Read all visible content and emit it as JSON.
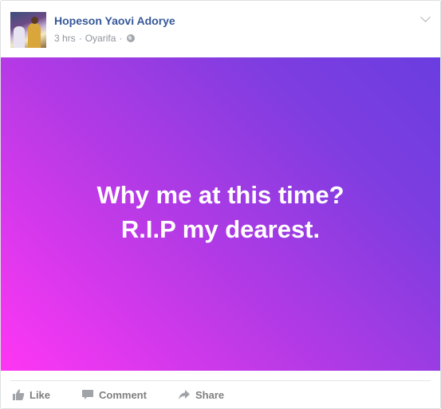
{
  "post": {
    "author_name": "Hopeson Yaovi Adorye",
    "time": "3 hrs",
    "location": "Oyarifa",
    "separator": "·",
    "text_line1": "Why me at this time?",
    "text_line2": "R.I.P my dearest."
  },
  "actions": {
    "like_label": "Like",
    "comment_label": "Comment",
    "share_label": "Share"
  },
  "colors": {
    "author_link": "#365899",
    "meta_text": "#90949c",
    "action_text": "#7f7f7f",
    "gradient_start": "#ff36f4",
    "gradient_end": "#6a3de0"
  },
  "icons": {
    "privacy": "globe-icon",
    "menu": "chevron-down-icon",
    "like": "like-icon",
    "comment": "comment-icon",
    "share": "share-icon"
  }
}
